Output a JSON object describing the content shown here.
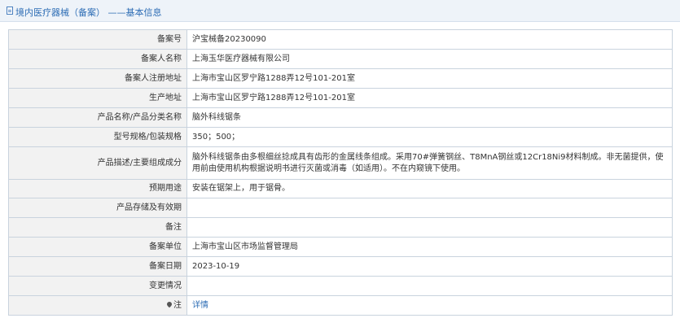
{
  "header": {
    "title": "境内医疗器械（备案） ——基本信息",
    "icon": "document-icon",
    "accent_color": "#2d6db5"
  },
  "rows": [
    {
      "label": "备案号",
      "value": "沪宝械备20230090"
    },
    {
      "label": "备案人名称",
      "value": "上海玉华医疗器械有限公司"
    },
    {
      "label": "备案人注册地址",
      "value": "上海市宝山区罗宁路1288弄12号101-201室"
    },
    {
      "label": "生产地址",
      "value": "上海市宝山区罗宁路1288弄12号101-201室"
    },
    {
      "label": "产品名称/产品分类名称",
      "value": "脑外科线锯条"
    },
    {
      "label": "型号规格/包装规格",
      "value": "350；500；"
    },
    {
      "label": "产品描述/主要组成成分",
      "value": "脑外科线锯条由多根细丝捻成具有齿形的金属线条组成。采用70#弹簧钢丝、T8MnA钢丝或12Cr18Ni9材料制成。非无菌提供，使用前由使用机构根据说明书进行灭菌或消毒（如适用）。不在内窥镜下使用。"
    },
    {
      "label": "预期用途",
      "value": "安装在锯架上，用于锯骨。"
    },
    {
      "label": "产品存储及有效期",
      "value": ""
    },
    {
      "label": "备注",
      "value": ""
    },
    {
      "label": "备案单位",
      "value": "上海市宝山区市场监督管理局"
    },
    {
      "label": "备案日期",
      "value": "2023-10-19"
    },
    {
      "label": "变更情况",
      "value": ""
    }
  ],
  "detail_row": {
    "label_icon": "pin-icon",
    "link_text": "详情"
  }
}
